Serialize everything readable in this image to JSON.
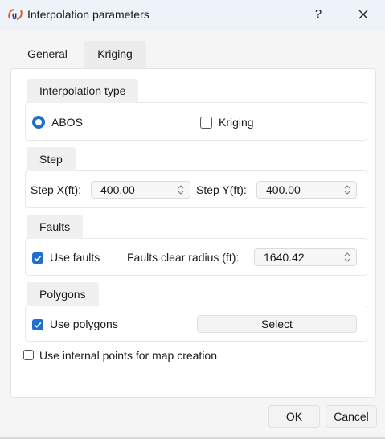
{
  "window": {
    "title": "Interpolation parameters",
    "help_glyph": "?",
    "app_icon": "g9-logo-icon",
    "accent_color": "#1e6fd0"
  },
  "tabs": [
    {
      "label": "General",
      "active": false
    },
    {
      "label": "Kriging",
      "active": true
    }
  ],
  "interpolation_type": {
    "title": "Interpolation type",
    "options": [
      {
        "label": "ABOS",
        "selected": true
      },
      {
        "label": "Kriging",
        "selected": false
      }
    ]
  },
  "step": {
    "title": "Step",
    "x_label": "Step X(ft):",
    "x_value": "400.00",
    "y_label": "Step Y(ft):",
    "y_value": "400.00"
  },
  "faults": {
    "title": "Faults",
    "use_label": "Use faults",
    "use_checked": true,
    "radius_label": "Faults clear radius (ft):",
    "radius_value": "1640.42"
  },
  "polygons": {
    "title": "Polygons",
    "use_label": "Use polygons",
    "use_checked": true,
    "select_label": "Select"
  },
  "internal_points": {
    "label": "Use internal points for map creation",
    "checked": false
  },
  "footer": {
    "ok_label": "OK",
    "cancel_label": "Cancel"
  }
}
